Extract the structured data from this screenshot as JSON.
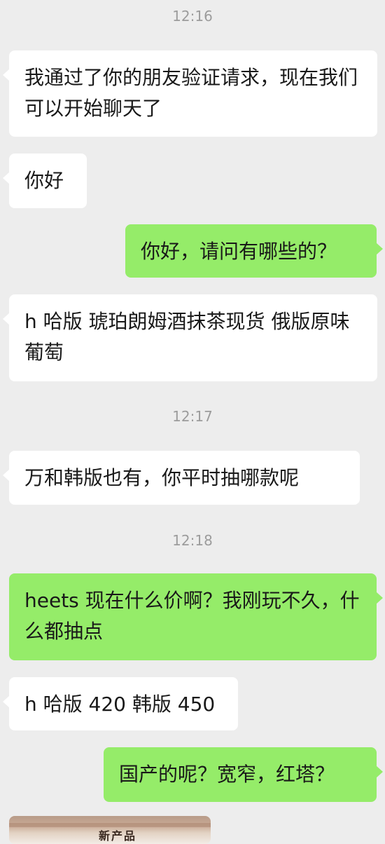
{
  "messages": [
    {
      "type": "timestamp",
      "text": "12:16"
    },
    {
      "type": "in",
      "text": "我通过了你的朋友验证请求，现在我们可以开始聊天了"
    },
    {
      "type": "in",
      "text": "你好"
    },
    {
      "type": "out",
      "text": "你好，请问有哪些的？"
    },
    {
      "type": "in",
      "text": "h 哈版 琥珀朗姆酒抹茶现货 俄版原味葡萄"
    },
    {
      "type": "timestamp",
      "text": "12:17"
    },
    {
      "type": "in",
      "text": "万和韩版也有，你平时抽哪款呢"
    },
    {
      "type": "timestamp",
      "text": "12:18"
    },
    {
      "type": "out",
      "text": "heets 现在什么价啊？我刚玩不久，什么都抽点"
    },
    {
      "type": "in",
      "text": "h 哈版 420 韩版 450"
    },
    {
      "type": "out",
      "text": "国产的呢？宽窄，红塔？"
    },
    {
      "type": "image",
      "caption": "新产品"
    }
  ],
  "colors": {
    "background": "#ededed",
    "incoming_bubble": "#ffffff",
    "outgoing_bubble": "#95ec69",
    "timestamp": "#9c9c9c",
    "text": "#191919"
  }
}
